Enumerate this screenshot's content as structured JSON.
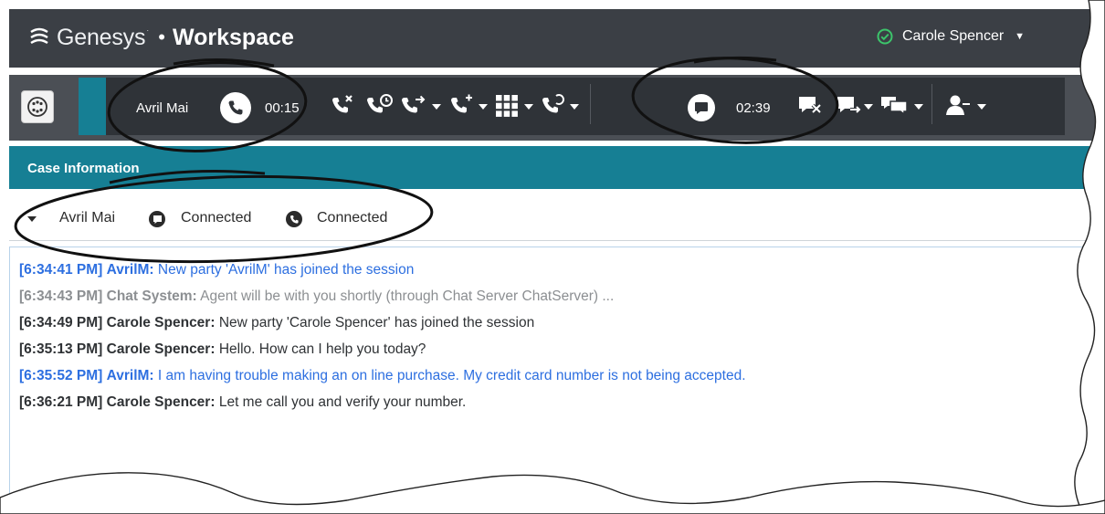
{
  "titlebar": {
    "brand": "Genesys",
    "brand_mark": "·",
    "separator": "•",
    "product": "Workspace",
    "agent_status_icon": "check-circle-icon",
    "agent_name": "Carole Spencer",
    "colors": {
      "background": "#3b3f45",
      "status_ok": "#3cc46b"
    }
  },
  "toolbar": {
    "call": {
      "party": "Avril Mai",
      "icon": "phone-icon",
      "timer": "00:15"
    },
    "call_actions": [
      {
        "icon": "end-call-icon"
      },
      {
        "icon": "hold-call-icon"
      },
      {
        "icon": "transfer-call-icon"
      },
      {
        "icon": "conference-call-icon"
      },
      {
        "icon": "keypad-icon"
      },
      {
        "icon": "consult-call-icon"
      }
    ],
    "chat": {
      "icon": "chat-bubble-icon",
      "timer": "02:39"
    },
    "chat_actions": [
      {
        "icon": "end-chat-icon"
      },
      {
        "icon": "transfer-chat-icon"
      },
      {
        "icon": "consult-chat-icon"
      },
      {
        "icon": "party-action-icon"
      }
    ],
    "colors": {
      "accent": "#167f94",
      "bar": "#2f3338"
    }
  },
  "case": {
    "title": "Case Information",
    "party_name": "Avril Mai",
    "chat_status": "Connected",
    "voice_status": "Connected"
  },
  "transcript": [
    {
      "time": "[6:34:41 PM]",
      "sender": "AvrilM:",
      "text": "New party 'AvrilM' has joined the session",
      "color": "#2d6fe0"
    },
    {
      "time": "[6:34:43 PM]",
      "sender": "Chat System:",
      "text": "Agent will be with you shortly (through Chat Server ChatServer) ...",
      "color": "#8c8f92"
    },
    {
      "time": "[6:34:49 PM]",
      "sender": "Carole Spencer:",
      "text": "New party 'Carole Spencer' has joined the session",
      "color": "#2f3235"
    },
    {
      "time": "[6:35:13 PM]",
      "sender": "Carole Spencer:",
      "text": "Hello. How can I help you today?",
      "color": "#2f3235"
    },
    {
      "time": "[6:35:52 PM]",
      "sender": "AvrilM:",
      "text": "I am having trouble making an on line purchase. My credit card number is not being accepted.",
      "color": "#2d6fe0"
    },
    {
      "time": "[6:36:21 PM]",
      "sender": "Carole Spencer:",
      "text": "Let me call you and verify your number.",
      "color": "#2f3235"
    }
  ]
}
